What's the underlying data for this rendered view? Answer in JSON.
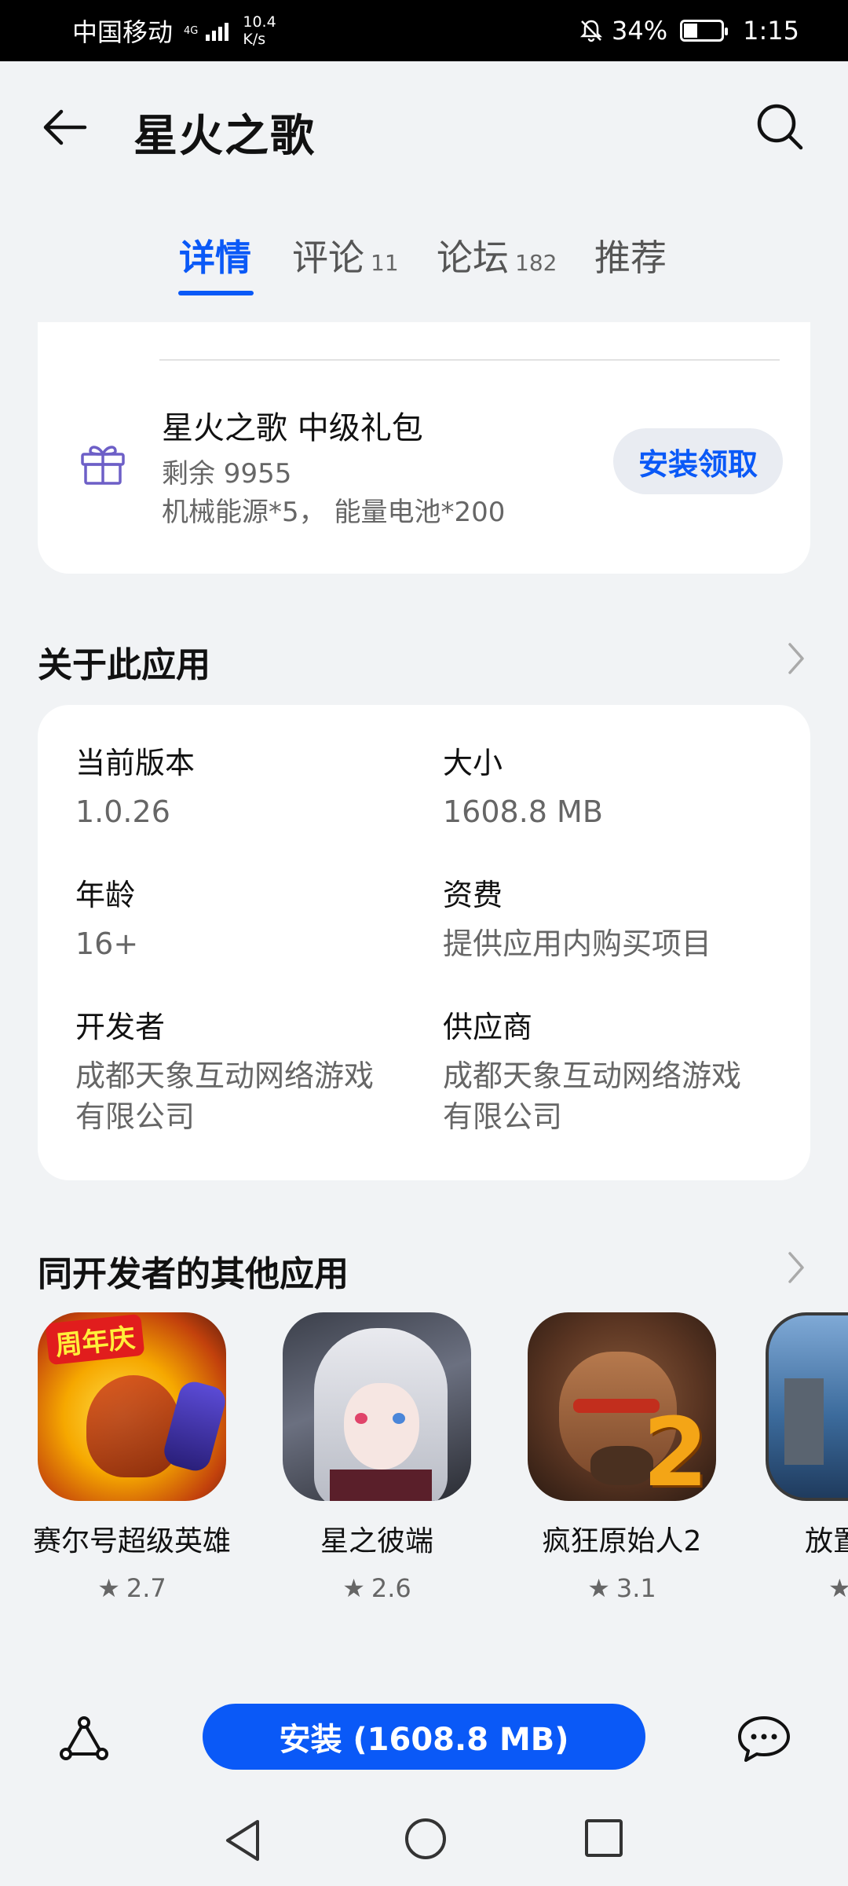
{
  "status_bar": {
    "carrier": "中国移动",
    "network_type": "4G",
    "speed_value": "10.4",
    "speed_unit": "K/s",
    "battery": "34%",
    "time": "1:15"
  },
  "header": {
    "title": "星火之歌"
  },
  "tabs": [
    {
      "label": "详情",
      "count": ""
    },
    {
      "label": "评论",
      "count": "11"
    },
    {
      "label": "论坛",
      "count": "182"
    },
    {
      "label": "推荐",
      "count": ""
    }
  ],
  "gift": {
    "title": "星火之歌 中级礼包",
    "remaining": "剩余  9955",
    "items": "机械能源*5， 能量电池*200",
    "button_label": "安装领取"
  },
  "about": {
    "title": "关于此应用",
    "version_label": "当前版本",
    "version_value": "1.0.26",
    "size_label": "大小",
    "size_value": "1608.8 MB",
    "age_label": "年龄",
    "age_value": "16+",
    "fee_label": "资费",
    "fee_value": "提供应用内购买项目",
    "developer_label": "开发者",
    "developer_value_line1": "成都天象互动网络游戏",
    "developer_value_line2": "有限公司",
    "supplier_label": "供应商",
    "supplier_value_line1": "成都天象互动网络游戏",
    "supplier_value_line2": "有限公司"
  },
  "developer_apps": {
    "title": "同开发者的其他应用",
    "items": [
      {
        "name": "赛尔号超级英雄",
        "rating": "2.7",
        "icon_text": "周年庆"
      },
      {
        "name": "星之彼端",
        "rating": "2.6"
      },
      {
        "name": "疯狂原始人2",
        "rating": "3.1",
        "icon_text": "2"
      },
      {
        "name": "放置",
        "rating": ""
      }
    ]
  },
  "bottom": {
    "install_label": "安装 (1608.8 MB)"
  },
  "colors": {
    "accent": "#0a59f7",
    "background": "#f1f3f5",
    "card": "#ffffff"
  }
}
